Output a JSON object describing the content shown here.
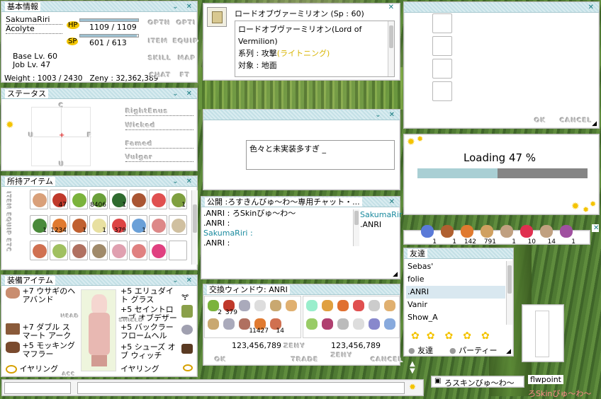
{
  "basic_info": {
    "title": "基本情報",
    "name": "SakumaRiri",
    "job": "Acolyte",
    "hp_label": "HP",
    "hp": "1109 / 1109",
    "sp_label": "SP",
    "sp": "601 / 613",
    "hp_fraction": 1.0,
    "sp_fraction": 0.98,
    "base_lv": "Base Lv. 60",
    "job_lv": "Job Lv. 47",
    "weight_zeny": "Weight : 1003 / 2430   Zeny : 32,362,389",
    "menu": [
      "OPTN",
      "OPTI",
      "ITEM",
      "EQUIP",
      "SKILL",
      "MAP",
      "CHAT",
      "FT"
    ]
  },
  "status": {
    "title": "ステータス",
    "axis": [
      "S",
      "C",
      "U",
      "F",
      "U"
    ],
    "fields": [
      "RightEnus",
      "Wicked",
      "Famed",
      "Vulgar"
    ]
  },
  "inventory": {
    "title": "所持アイテム",
    "side_label": "ITEM EQUIP ETC",
    "counts": [
      "",
      "47",
      "",
      "8406",
      "1",
      "",
      "",
      "1",
      "1",
      "1234",
      "1",
      "1",
      "379",
      "1",
      "",
      "",
      "",
      "",
      "",
      "",
      "",
      "",
      "",
      ""
    ]
  },
  "equipment": {
    "title": "装備アイテム",
    "left": [
      "+7 ウサギのヘアバンド",
      "+7 ダブル スマート アーク",
      "+5 モッキング マフラー",
      "イヤリング"
    ],
    "right": [
      "+5 エリュダイト グラス",
      "+5 セイントローブ オブデザー",
      "+5 バックラー フロームヘル",
      "+5 シューズ オブ ウィッチ",
      "イヤリング"
    ],
    "slot_labels": [
      "HEAD",
      "SHIELD",
      "ACC",
      "FOOT",
      "GARM",
      "ACC"
    ]
  },
  "skill_desc": {
    "header": "ロードオブヴァーミリオン (Sp : 60)",
    "line1": "ロードオブヴァーミリオン(Lord of",
    "line2": "Vermilion)",
    "line3_prefix": "系列 : 攻撃",
    "line3_accent": "(ライトニング)",
    "line4": "対象 : 地面"
  },
  "input_dialog": {
    "value": "色々と未実装多すぎ _"
  },
  "public_chat": {
    "title": "公開 :ろすきんびゅ〜わ〜専用チャット・...",
    "lines": [
      ".ANRI : ろSkinびゅ〜わ〜",
      ".ANRI :",
      "SakumaRiri :",
      ".ANRI :"
    ],
    "members": [
      "SakumaRir",
      ".ANRI"
    ]
  },
  "trade": {
    "title": "交換ウィンドウ: ANRI",
    "left_counts": [
      "2",
      "379",
      "",
      "",
      "",
      "",
      "",
      "",
      "1",
      "1427",
      "14"
    ],
    "zeny_left": "123,456,789",
    "zeny_right": "123,456,789",
    "zeny_label": "ZENY",
    "ok": "OK",
    "trade": "TRADE",
    "cancel": "CANCEL"
  },
  "storage": {
    "ok": "OK",
    "cancel": "CANCEL"
  },
  "loading": {
    "text": "Loading 47 %",
    "progress": 0.47
  },
  "shortcut": {
    "counts": [
      "1",
      "1",
      "142",
      "791",
      "1",
      "10",
      "14",
      "1"
    ]
  },
  "friends": {
    "title": "友達",
    "list": [
      "Sebas'",
      "folie",
      ".ANRI",
      "Vanir",
      "Show_A"
    ],
    "selected_index": 2,
    "tab_friends": "友達",
    "tab_party": "パーティー"
  },
  "bottom": {
    "chat_tab": "ろスキンびゅ〜わ〜",
    "player_tag": "flwpoint",
    "guild_tag": "ろSkinびゅ〜わ〜"
  },
  "colors": {
    "accent": "#d8b400",
    "title_bg": "#cfe7ec",
    "highlight": "#d9e8f0",
    "link": "#1a8a9e"
  }
}
